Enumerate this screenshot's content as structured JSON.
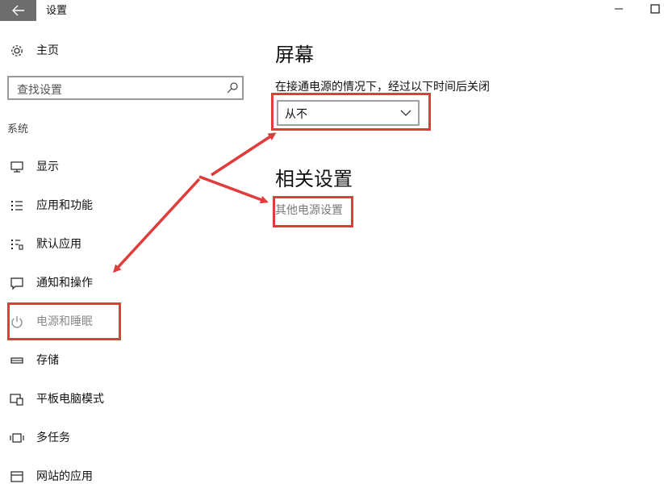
{
  "window": {
    "title": "设置",
    "back_icon": "back-arrow-icon",
    "minimize_glyph": "—",
    "maximize_icon": "maximize-icon"
  },
  "sidebar": {
    "home_label": "主页",
    "search_placeholder": "查找设置",
    "section_label": "系统",
    "items": [
      {
        "label": "显示",
        "icon": "monitor-icon"
      },
      {
        "label": "应用和功能",
        "icon": "apps-list-icon"
      },
      {
        "label": "默认应用",
        "icon": "default-apps-icon"
      },
      {
        "label": "通知和操作",
        "icon": "notification-icon"
      },
      {
        "label": "电源和睡眠",
        "icon": "power-icon",
        "active": true
      },
      {
        "label": "存储",
        "icon": "storage-icon"
      },
      {
        "label": "平板电脑模式",
        "icon": "tablet-mode-icon"
      },
      {
        "label": "多任务",
        "icon": "multitasking-icon"
      },
      {
        "label": "网站的应用",
        "icon": "apps-for-websites-icon"
      }
    ]
  },
  "main": {
    "screen_heading": "屏幕",
    "screen_description": "在接通电源的情况下，经过以下时间后关闭",
    "screen_timeout_value": "从不",
    "related_heading": "相关设置",
    "related_link": "其他电源设置"
  },
  "colors": {
    "annotation": "#e03c3c",
    "back_button_bg": "#6d6d6d",
    "link_gray": "#7a7a7a"
  }
}
